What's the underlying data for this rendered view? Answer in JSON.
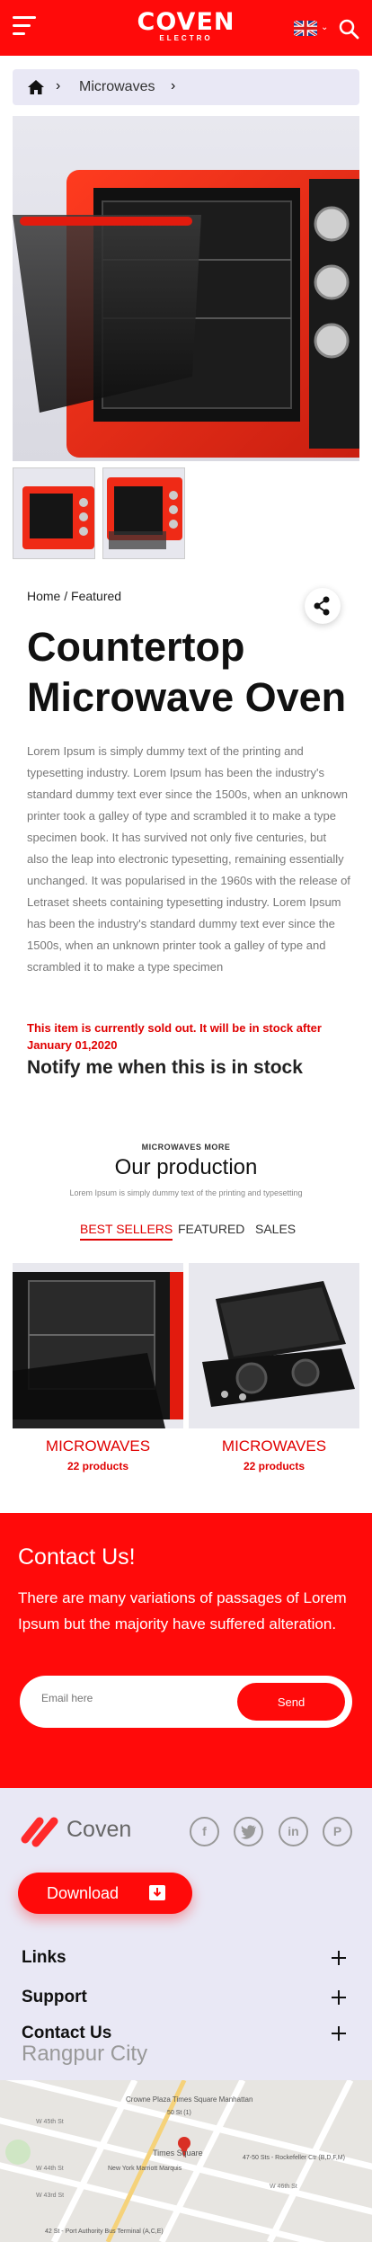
{
  "header": {
    "logo_word": "COVEN",
    "logo_sub": "ELECTRO",
    "language": "English (UK)"
  },
  "breadcrumb": {
    "category": "Microwaves"
  },
  "product": {
    "trail": "Home / Featured",
    "title": "Countertop Microwave Oven",
    "description": "Lorem Ipsum is simply dummy text of the printing and typesetting industry. Lorem Ipsum has been the industry's standard dummy text ever since the 1500s, when an unknown printer took a galley of type and scrambled it to make a type specimen book. It has survived not only five centuries, but also the leap into electronic typesetting, remaining essentially unchanged. It was popularised in the 1960s with the release of Letraset sheets containing typesetting industry. Lorem Ipsum has been the industry's standard dummy text ever since the 1500s, when an unknown printer took a galley of type and scrambled it to make a type specimen",
    "stock_notice": "This item is currently sold out. It will be in stock after January 01,2020",
    "notify_label": "Notify me when this is in stock"
  },
  "production": {
    "eyebrow": "MICROWAVES MORE",
    "title": "Our production",
    "subtitle": "Lorem Ipsum is simply dummy text of the printing and typesetting",
    "tabs": [
      {
        "label": "BEST SELLERS",
        "active": true
      },
      {
        "label": "FEATURED",
        "active": false
      },
      {
        "label": "SALES",
        "active": false
      }
    ],
    "cards": [
      {
        "name": "MICROWAVES",
        "count": "22 products"
      },
      {
        "name": "MICROWAVES",
        "count": "22 products"
      }
    ]
  },
  "contact": {
    "title": "Contact Us!",
    "text": "There are many variations of passages of Lorem Ipsum  but the majority have suffered alteration.",
    "email_placeholder": "Email here",
    "send_label": "Send"
  },
  "footer": {
    "brand": "Coven",
    "download_label": "Download",
    "sections": [
      "Links",
      "Support",
      "Contact Us"
    ],
    "city": "Rangpur City",
    "social": [
      "facebook-icon",
      "twitter-icon",
      "linkedin-icon",
      "pinterest-icon"
    ]
  },
  "map": {
    "labels": [
      "Crowne Plaza Times Square Manhattan",
      "Times Square",
      "47-50 Sts - Rockefeller Ctr (B,D,F,M)",
      "New York Marriott Marquis",
      "42 St - Port Authority Bus Terminal (A,C,E)",
      "W 45th St",
      "W 44th St",
      "W 43rd St",
      "W 46th St",
      "50 St (1)"
    ]
  },
  "colors": {
    "brand_red": "#ff0a0a",
    "lavender": "#e9e8f5"
  }
}
